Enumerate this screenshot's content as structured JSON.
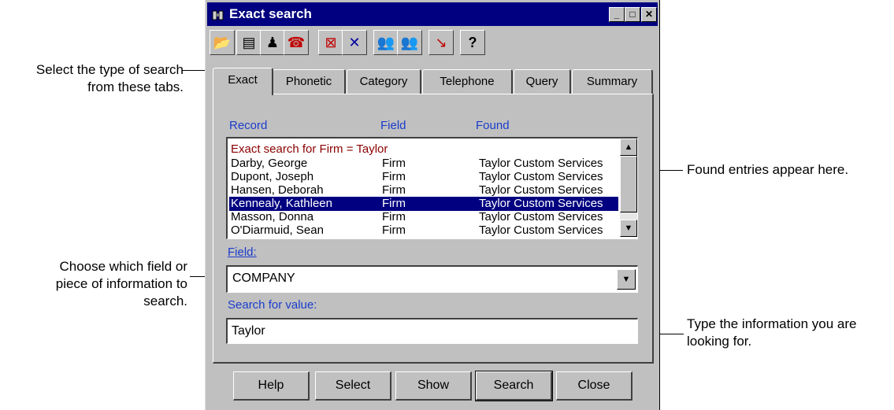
{
  "window": {
    "title": "Exact search"
  },
  "toolbar": [
    "open-folder",
    "list-view",
    "person-up",
    "telephone",
    "delete-doc",
    "cross",
    "people",
    "people-dim",
    "chart",
    "help"
  ],
  "toolbar_help_glyph": "?",
  "tabs": [
    "Exact",
    "Phonetic",
    "Category",
    "Telephone",
    "Query",
    "Summary"
  ],
  "list": {
    "headers": {
      "record": "Record",
      "field": "Field",
      "found": "Found"
    },
    "title_row": "Exact search for Firm = Taylor",
    "rows": [
      {
        "record": "Darby, George",
        "field": "Firm",
        "found": "Taylor Custom Services"
      },
      {
        "record": "Dupont, Joseph",
        "field": "Firm",
        "found": "Taylor Custom Services"
      },
      {
        "record": "Hansen, Deborah",
        "field": "Firm",
        "found": "Taylor Custom Services"
      },
      {
        "record": "Kennealy, Kathleen",
        "field": "Firm",
        "found": "Taylor Custom Services"
      },
      {
        "record": "Masson, Donna",
        "field": "Firm",
        "found": "Taylor Custom Services"
      },
      {
        "record": "O'Diarmuid, Sean",
        "field": "Firm",
        "found": "Taylor Custom Services"
      }
    ],
    "selected_index": 3
  },
  "field": {
    "label": "Field:",
    "value": "COMPANY"
  },
  "search": {
    "label": "Search for value:",
    "value": "Taylor"
  },
  "buttons": {
    "help": "Help",
    "select": "Select",
    "show": "Show",
    "search": "Search",
    "close": "Close"
  },
  "callouts": {
    "tabs": [
      "Select the type of search",
      "from these tabs."
    ],
    "field": [
      "Choose which field or",
      "piece of information to",
      "search."
    ],
    "found": [
      "Found entries appear here."
    ],
    "value": [
      "Type the information you are",
      "looking for."
    ]
  },
  "colors": {
    "title_bar": "#000080",
    "selection": "#000080",
    "header_text": "#1a3ccc",
    "title_row_text": "#8b0000"
  }
}
